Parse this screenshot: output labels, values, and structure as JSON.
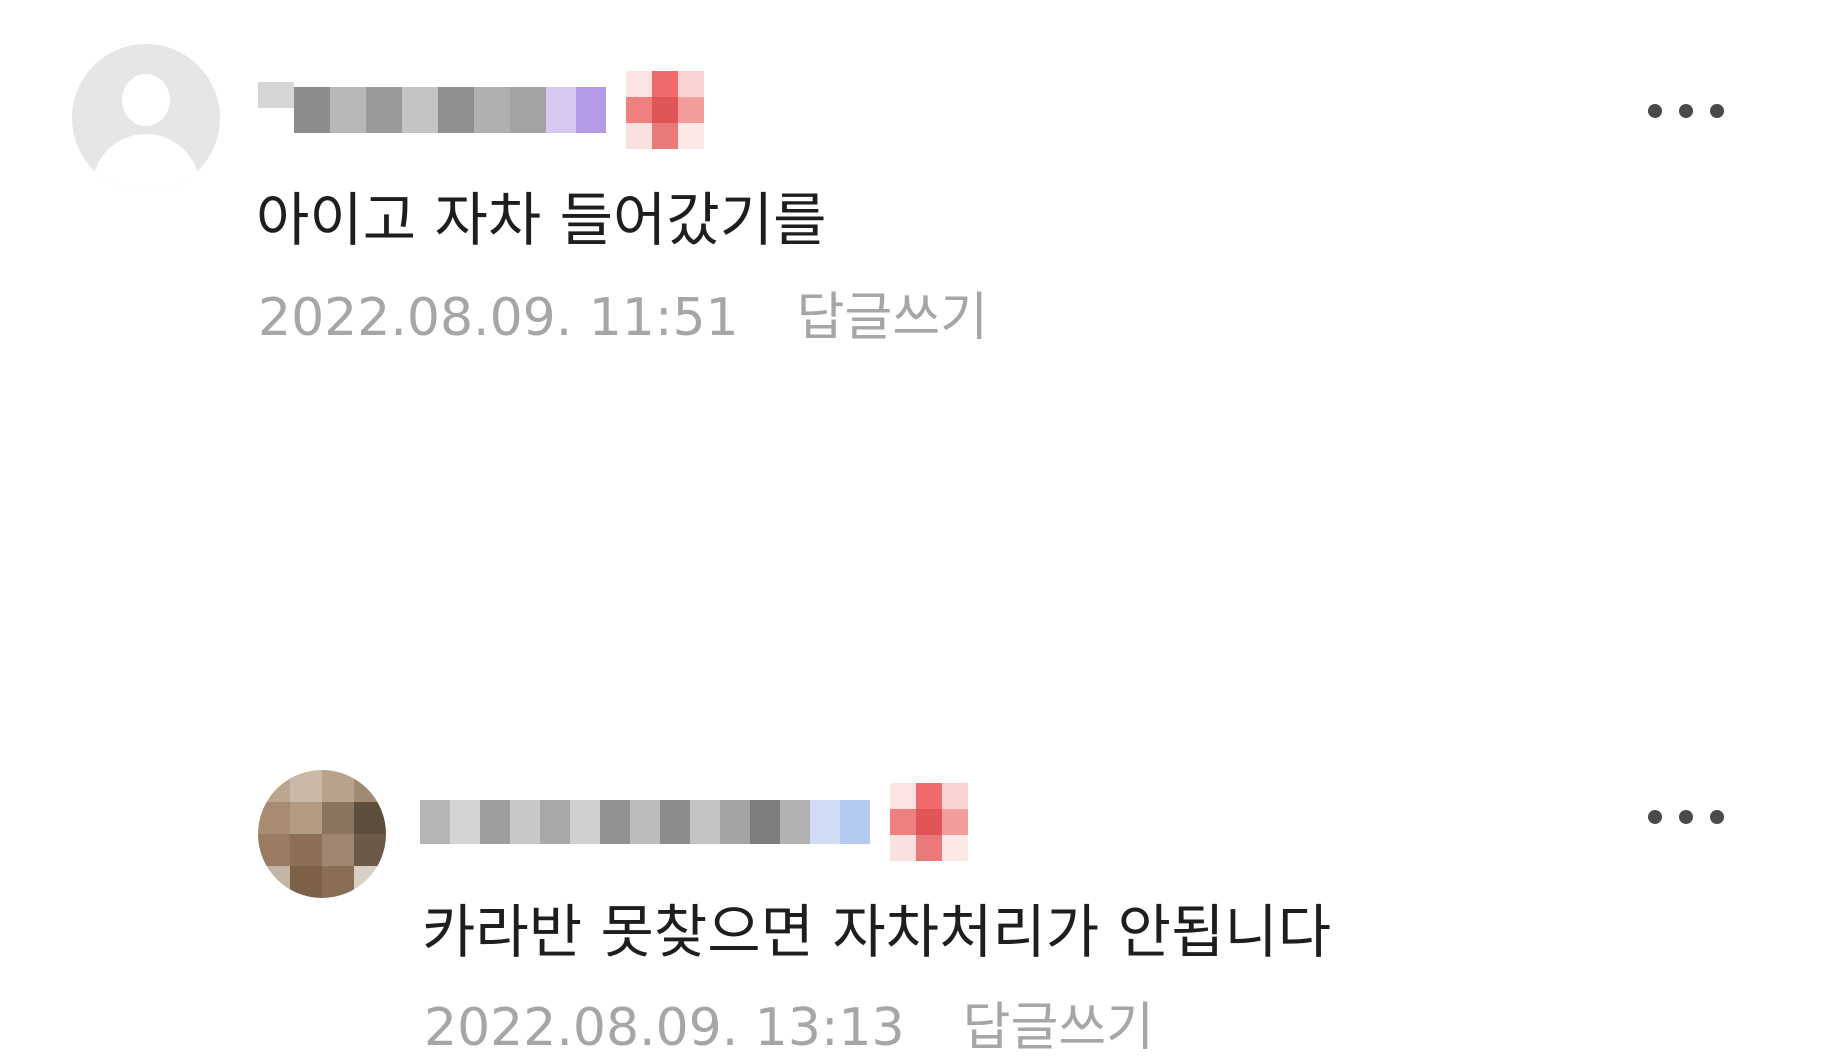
{
  "comments": [
    {
      "author": "",
      "text": "아이고 자차 들어갔기를",
      "date": "2022.08.09. 11:51",
      "reply_label": "답글쓰기"
    },
    {
      "author": "",
      "text": "카라반 못찾으면 자차처리가 안됩니다",
      "date": "2022.08.09. 13:13",
      "reply_label": "답글쓰기"
    }
  ],
  "more_icon": "more-horizontal-icon",
  "colors": {
    "text": "#1e1e1e",
    "meta": "#a6a6a6",
    "avatar_placeholder": "#e6e6e6",
    "badge_red": "#e05555"
  }
}
